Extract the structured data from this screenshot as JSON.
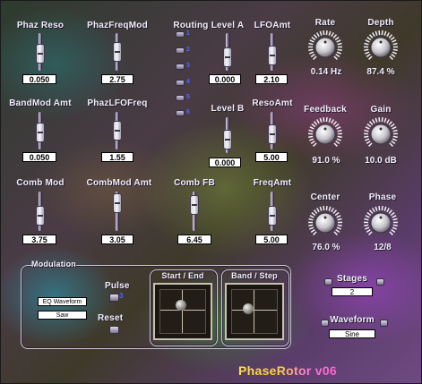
{
  "app": {
    "title": "PhaseRotor v06"
  },
  "sliders": [
    {
      "id": "phaz-reso",
      "label": "Phaz Reso",
      "value": "0.050"
    },
    {
      "id": "phaz-freq-mod",
      "label": "PhazFreqMod",
      "value": "2.75"
    },
    {
      "id": "bandmod-amt",
      "label": "BandMod Amt",
      "value": "0.050"
    },
    {
      "id": "phaz-lfo-freq",
      "label": "PhazLFOFreq",
      "value": "1.55"
    },
    {
      "id": "comb-mod",
      "label": "Comb Mod",
      "value": "3.75"
    },
    {
      "id": "combmod-amt",
      "label": "CombMod Amt",
      "value": "3.05"
    },
    {
      "id": "level-a",
      "label": "Level A",
      "value": "0.000"
    },
    {
      "id": "lfo-amt",
      "label": "LFOAmt",
      "value": "2.10"
    },
    {
      "id": "level-b",
      "label": "Level B",
      "value": "0.000"
    },
    {
      "id": "reso-amt",
      "label": "ResoAmt",
      "value": "5.00"
    },
    {
      "id": "comb-fb",
      "label": "Comb FB",
      "value": "6.45"
    },
    {
      "id": "freq-amt",
      "label": "FreqAmt",
      "value": "5.00"
    }
  ],
  "routing": {
    "label": "Routing",
    "options": [
      "1",
      "2",
      "3",
      "4",
      "5",
      "6"
    ]
  },
  "knobs": [
    {
      "id": "rate",
      "label": "Rate",
      "value": "0.14 Hz"
    },
    {
      "id": "depth",
      "label": "Depth",
      "value": "87.4 %"
    },
    {
      "id": "feedback",
      "label": "Feedback",
      "value": "91.0 %"
    },
    {
      "id": "gain",
      "label": "Gain",
      "value": "10.0 dB"
    },
    {
      "id": "center",
      "label": "Center",
      "value": "76.0 %"
    },
    {
      "id": "phase",
      "label": "Phase",
      "value": "12/8"
    }
  ],
  "modulation": {
    "label": "Modulation",
    "lfo_waveform": "EQ Waveform",
    "lfo_shape": "Saw",
    "pulse_label": "Pulse",
    "pulse_value": "3",
    "reset_label": "Reset",
    "start_end_label": "Start / End",
    "band_step_label": "Band / Step"
  },
  "stages": {
    "label": "Stages",
    "value": "2"
  },
  "waveform": {
    "label": "Waveform",
    "value": "Sine"
  }
}
